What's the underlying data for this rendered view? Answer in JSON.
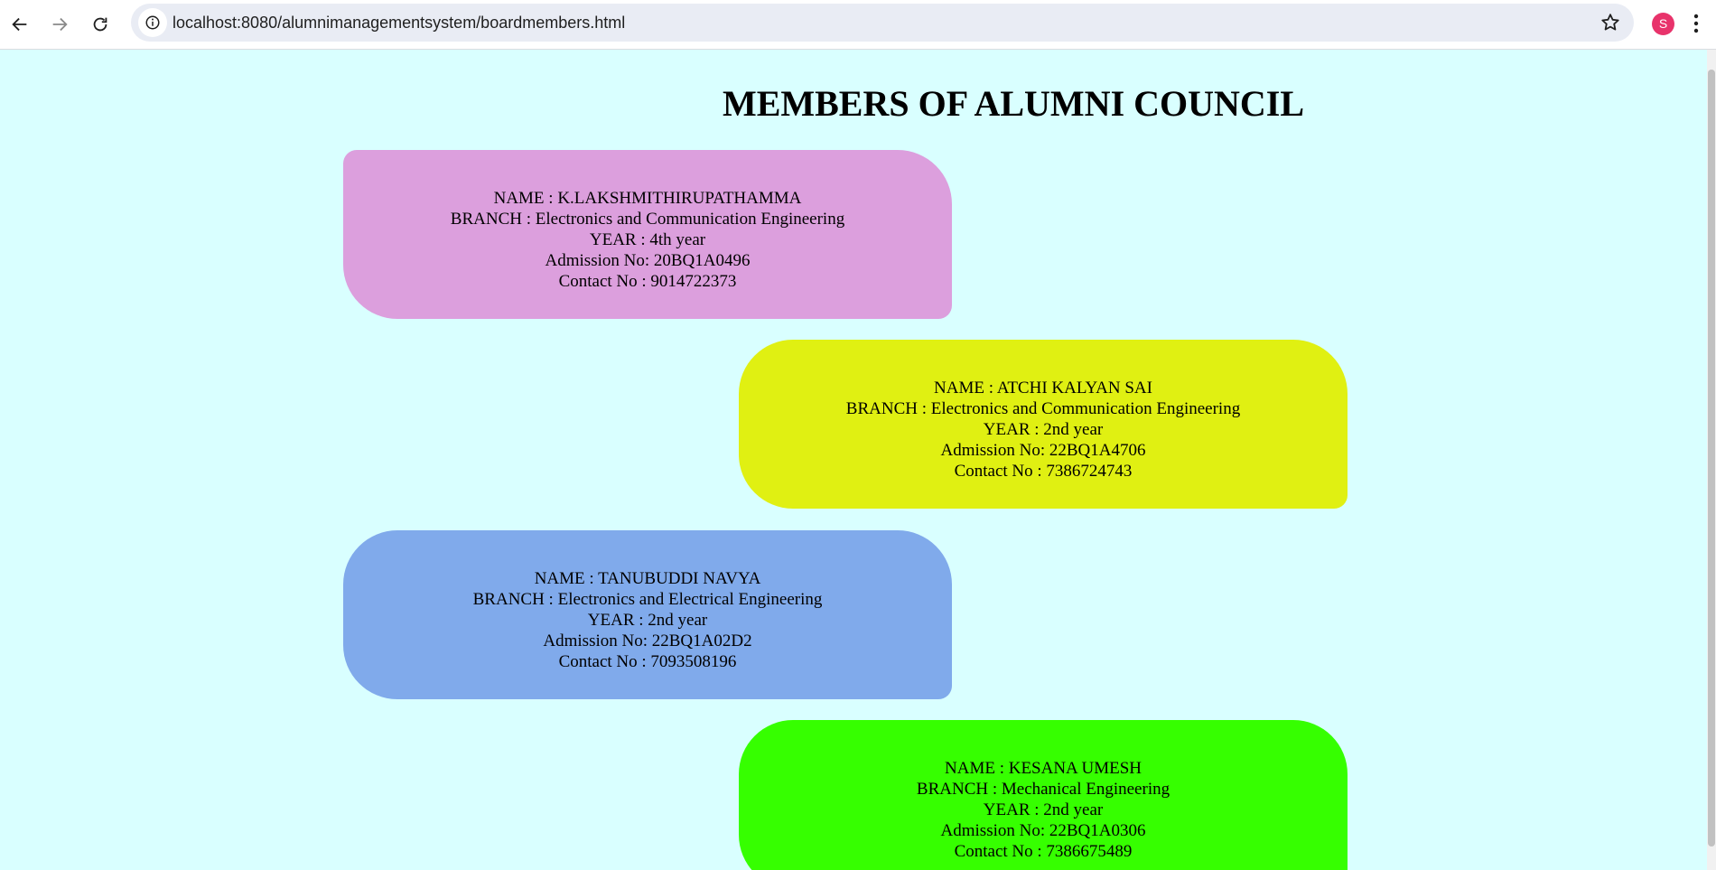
{
  "browser": {
    "url": "localhost:8080/alumnimanagementsystem/boardmembers.html",
    "profile_initial": "S"
  },
  "page": {
    "title": "MEMBERS OF ALUMNI COUNCIL",
    "background_color": "#d9ffff"
  },
  "members": [
    {
      "name": "NAME : K.LAKSHMITHIRUPATHAMMA",
      "branch": "BRANCH : Electronics and Communication Engineering",
      "year": "YEAR : 4th year",
      "admission": "Admission No: 20BQ1A0496",
      "contact": "Contact No : 9014722373",
      "color": "#dc9fdd"
    },
    {
      "name": "NAME : ATCHI KALYAN SAI",
      "branch": "BRANCH : Electronics and Communication Engineering",
      "year": "YEAR : 2nd year",
      "admission": "Admission No: 22BQ1A4706",
      "contact": "Contact No : 7386724743",
      "color": "#e0f012"
    },
    {
      "name": "NAME : TANUBUDDI NAVYA",
      "branch": "BRANCH : Electronics and Electrical Engineering",
      "year": "YEAR : 2nd year",
      "admission": "Admission No: 22BQ1A02D2",
      "contact": "Contact No : 7093508196",
      "color": "#80aaeb"
    },
    {
      "name": "NAME : KESANA UMESH",
      "branch": "BRANCH : Mechanical Engineering",
      "year": "YEAR : 2nd year",
      "admission": "Admission No: 22BQ1A0306",
      "contact": "Contact No : 7386675489",
      "color": "#36ff00"
    }
  ]
}
